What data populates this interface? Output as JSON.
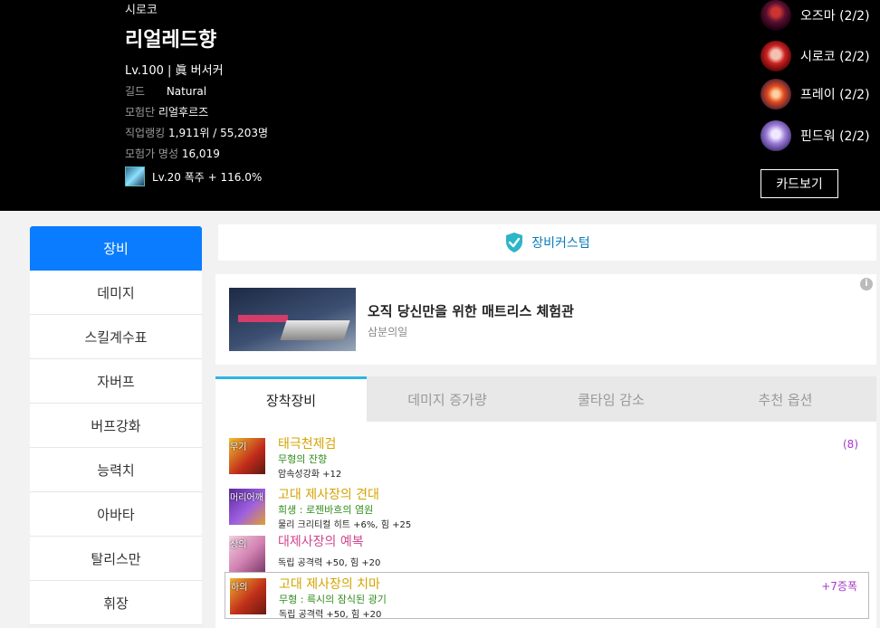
{
  "character": {
    "world": "시로코",
    "name": "리얼레드향",
    "level_job": "Lv.100 | 眞 버서커",
    "guild_label": "길드",
    "guild_value": "Natural",
    "union_label": "모험단",
    "union_value": "리얼후르즈",
    "rank_label": "직업랭킹",
    "rank_value": "1,911위 / 55,203명",
    "fame_label": "모험가 명성",
    "fame_value": "16,019",
    "link_text": "Lv.20 폭주 + 116.0%"
  },
  "union_characters": [
    {
      "name": "오즈마 (2/2)",
      "icon": "ozma-avatar"
    },
    {
      "name": "시로코 (2/2)",
      "icon": "siroco-avatar"
    },
    {
      "name": "프레이 (2/2)",
      "icon": "prey-avatar"
    },
    {
      "name": "핀드워 (2/2)",
      "icon": "fiendwar-avatar"
    }
  ],
  "card_button": "카드보기",
  "sidebar": {
    "items": [
      "장비",
      "데미지",
      "스킬계수표",
      "자버프",
      "버프강화",
      "능력치",
      "아바타",
      "탈리스만",
      "휘장"
    ],
    "active_index": 0
  },
  "custom_bar_label": "장비커스텀",
  "ad": {
    "title": "오직 당신만을 위한 매트리스 체험관",
    "subtitle": "삼분의일",
    "info": "i"
  },
  "tabs": [
    "장착장비",
    "데미지 증가량",
    "쿨타임 감소",
    "추천 옵션"
  ],
  "equipment": [
    {
      "slot": "무기",
      "name": "태극천제검",
      "name_color": "#d4a300",
      "line2": "무형의 잔향",
      "line3": "암속성강화 +12",
      "right": "(8)"
    },
    {
      "slot": "머리어깨",
      "name": "고대 제사장의 견대",
      "name_color": "#d4a300",
      "line2": "희생 : 로젠바흐의 염원",
      "line3": "물리 크리티컬 히트 +6%, 힘 +25",
      "right": ""
    },
    {
      "slot": "상의",
      "name": "대제사장의 예복",
      "name_color": "#d1458c",
      "line2": "",
      "line3": "독립 공격력 +50, 힘 +20",
      "right": ""
    },
    {
      "slot": "하의",
      "name": "고대 제사장의 치마",
      "name_color": "#d4a300",
      "line2": "무형 : 륵시의 잠식된 광기",
      "line3": "독립 공격력 +50, 힘 +20",
      "right": "+7증폭"
    }
  ]
}
